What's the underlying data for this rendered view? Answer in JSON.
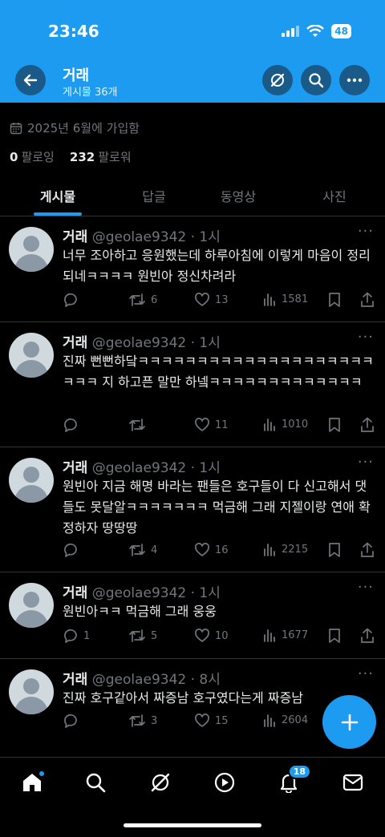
{
  "status": {
    "time": "23:46",
    "battery": "48"
  },
  "header": {
    "title": "거래",
    "subtitle": "게시물 36개"
  },
  "profile": {
    "joined": "2025년 6월에 가입함",
    "following_count": "0",
    "following_label": "팔로잉",
    "followers_count": "232",
    "followers_label": "팔로워"
  },
  "tabs": [
    "게시물",
    "답글",
    "동영상",
    "사진"
  ],
  "posts": [
    {
      "name": "거래",
      "handle": "@geolae9342",
      "time": "1시",
      "text": "너무 조아하고 응원했는데 하루아침에 이렇게 마음이 정리되네ㅋㅋㅋㅋ 원빈아 정신차려라",
      "replies": "",
      "reposts": "6",
      "likes": "13",
      "views": "1581"
    },
    {
      "name": "거래",
      "handle": "@geolae9342",
      "time": "1시",
      "text": "진짜 뻔뻔하닼ㅋㅋㅋㅋㅋㅋㅋㅋㅋㅋㅋㅋㅋㅋㅋㅋㅋㅋㅋㅋㅋㅋㅋ 지 하고픈 말만 하넼ㅋㅋㅋㅋㅋㅋㅋㅋㅋㅋㅋㅋㅋ",
      "replies": "",
      "reposts": "",
      "likes": "11",
      "views": "1010"
    },
    {
      "name": "거래",
      "handle": "@geolae9342",
      "time": "1시",
      "text": "원빈아 지금 해명 바라는 팬들은 호구들이 다 신고해서 댓들도 못달알ㅋㅋㅋㅋㅋㅋㅋ 먹금해 그래 지젤이랑 연애 확정하자 땅땅땅",
      "replies": "",
      "reposts": "4",
      "likes": "16",
      "views": "2215"
    },
    {
      "name": "거래",
      "handle": "@geolae9342",
      "time": "1시",
      "text": "원빈아ㅋㅋ 먹금해 그래 웅웅",
      "replies": "1",
      "reposts": "5",
      "likes": "10",
      "views": "1677"
    },
    {
      "name": "거래",
      "handle": "@geolae9342",
      "time": "8시",
      "text": "진짜 호구같아서 짜증남 호구였다는게 짜증남",
      "replies": "",
      "reposts": "3",
      "likes": "15",
      "views": "2604"
    }
  ],
  "nav": {
    "notifications_badge": "18"
  },
  "colors": {
    "accent": "#1d9bf0",
    "background": "#000000",
    "muted": "#71767b",
    "divider": "#2f3336"
  },
  "icons": [
    "back-arrow-icon",
    "grok-icon",
    "search-icon",
    "more-icon",
    "calendar-icon",
    "reply-icon",
    "repost-icon",
    "like-icon",
    "views-icon",
    "bookmark-icon",
    "share-icon",
    "compose-plus-icon",
    "home-icon",
    "explore-icon",
    "grok-nav-icon",
    "video-icon",
    "bell-icon",
    "mail-icon"
  ]
}
